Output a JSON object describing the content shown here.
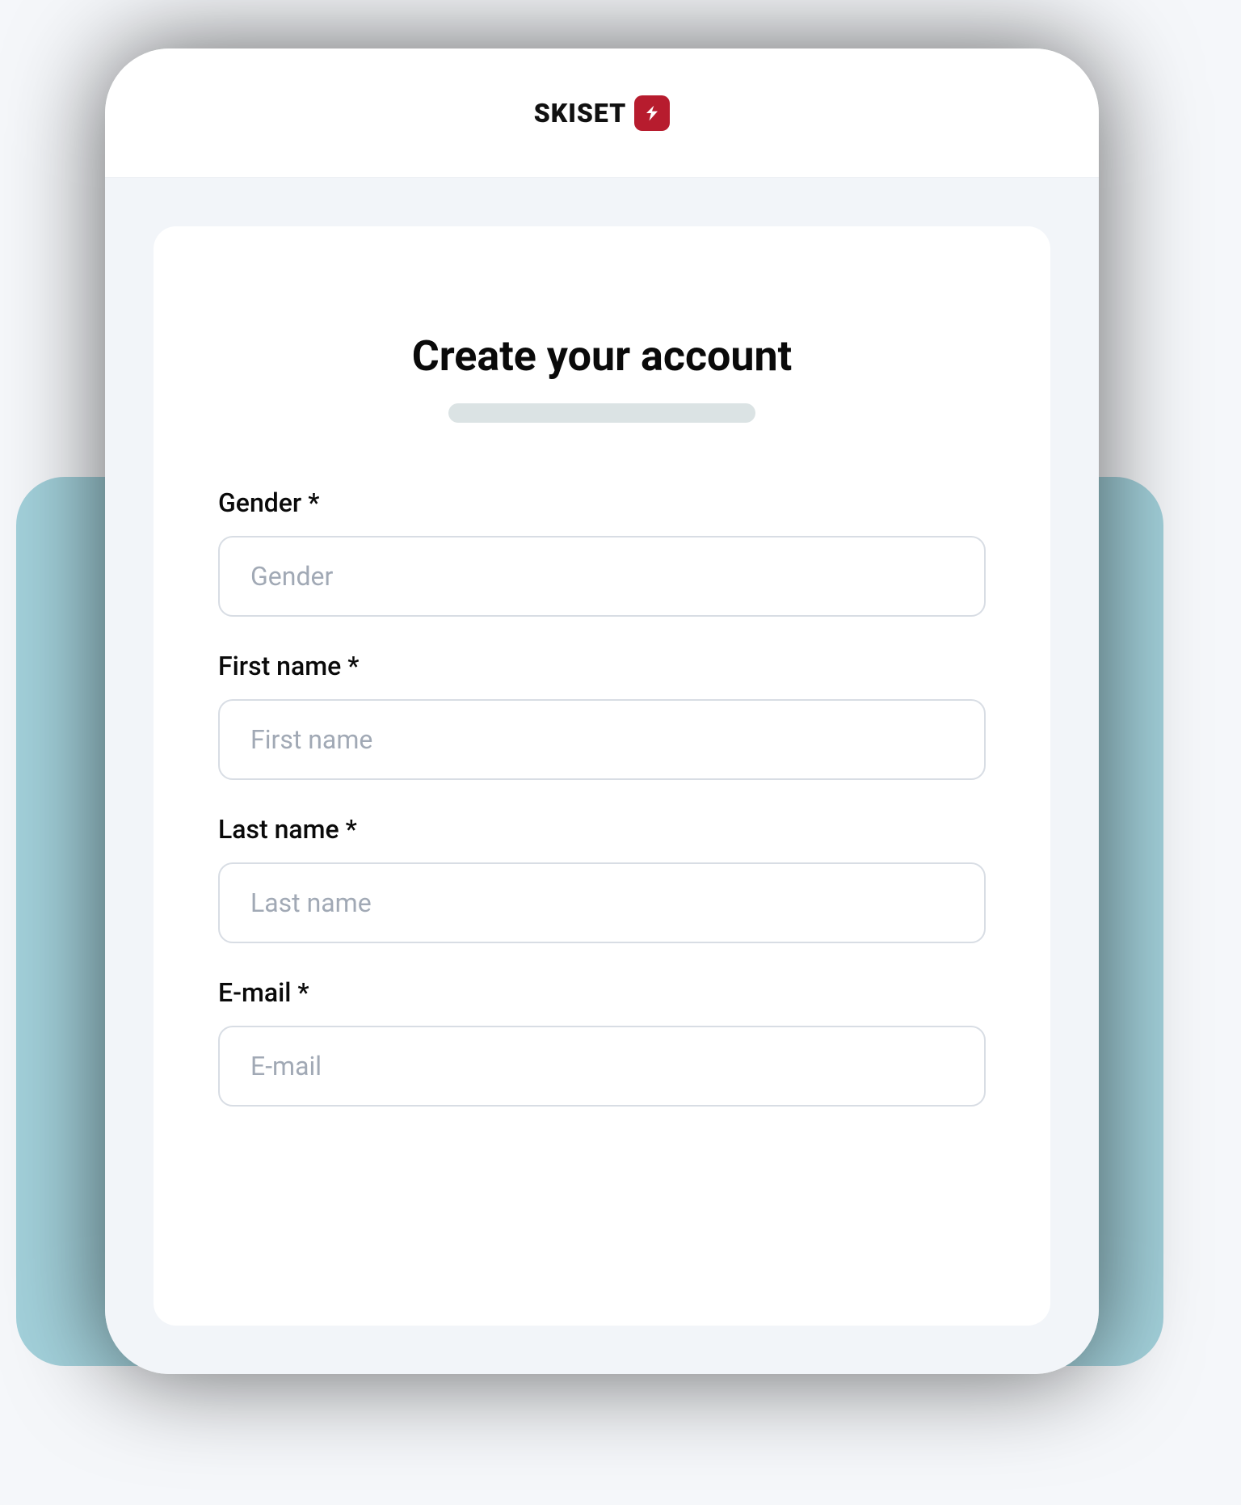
{
  "brand": {
    "name": "SKISET"
  },
  "form": {
    "title": "Create your account",
    "fields": {
      "gender": {
        "label": "Gender *",
        "placeholder": "Gender",
        "value": ""
      },
      "first_name": {
        "label": "First name *",
        "placeholder": "First name",
        "value": ""
      },
      "last_name": {
        "label": "Last name *",
        "placeholder": "Last name",
        "value": ""
      },
      "email": {
        "label": "E-mail *",
        "placeholder": "E-mail",
        "value": ""
      }
    }
  }
}
